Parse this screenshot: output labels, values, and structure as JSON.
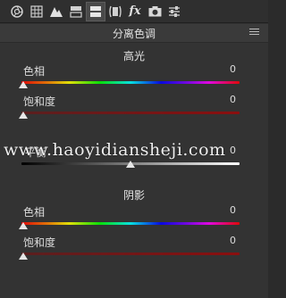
{
  "toolbar": {
    "tools": [
      {
        "icon": "aperture-icon"
      },
      {
        "icon": "grid-icon"
      },
      {
        "icon": "mountains-icon"
      },
      {
        "icon": "split-rows-icon"
      },
      {
        "icon": "split-toning-icon"
      },
      {
        "icon": "lens-icon"
      },
      {
        "icon": "fx-icon",
        "text": "fx"
      },
      {
        "icon": "camera-icon"
      },
      {
        "icon": "sliders-icon"
      }
    ]
  },
  "panel": {
    "title": "分离色调"
  },
  "highlights": {
    "title": "高光",
    "hue_label": "色相",
    "hue_value": "0",
    "saturation_label": "饱和度",
    "saturation_value": "0"
  },
  "balance": {
    "label": "平衡",
    "value": "0"
  },
  "shadows": {
    "title": "阴影",
    "hue_label": "色相",
    "hue_value": "0",
    "saturation_label": "饱和度",
    "saturation_value": "0"
  },
  "watermark": {
    "text": "www.haoyidiansheji.com"
  },
  "colors": {
    "background": "#333333",
    "text": "#dcdcdc"
  }
}
